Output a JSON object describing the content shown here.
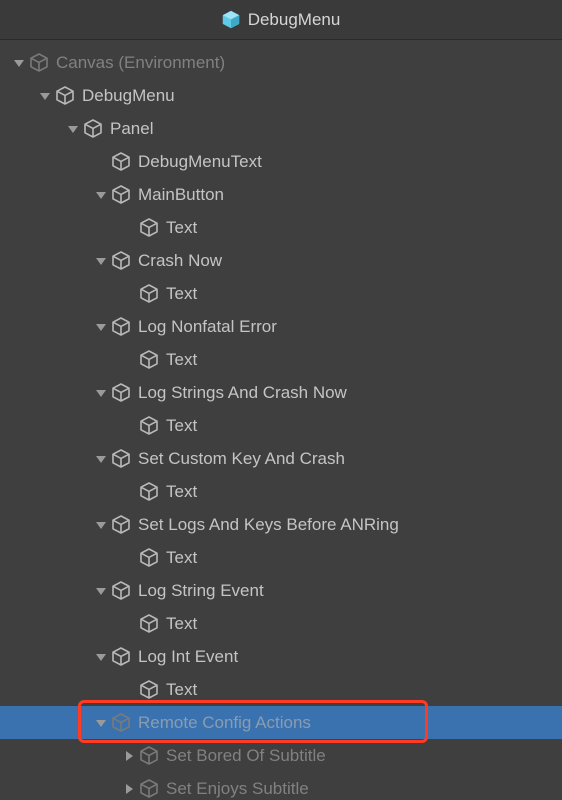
{
  "header": {
    "title": "DebugMenu"
  },
  "tree": {
    "canvas": "Canvas (Environment)",
    "debugMenu": "DebugMenu",
    "panel": "Panel",
    "debugMenuText": "DebugMenuText",
    "mainButton": "MainButton",
    "text": "Text",
    "crashNow": "Crash Now",
    "logNonfatal": "Log Nonfatal Error",
    "logStringsCrash": "Log Strings And Crash Now",
    "setCustomKeyCrash": "Set Custom Key And Crash",
    "setLogsKeysANR": "Set Logs And Keys Before ANRing",
    "logStringEvent": "Log String Event",
    "logIntEvent": "Log Int Event",
    "remoteConfig": "Remote Config Actions",
    "setBored": "Set Bored Of Subtitle",
    "setEnjoys": "Set Enjoys Subtitle"
  }
}
